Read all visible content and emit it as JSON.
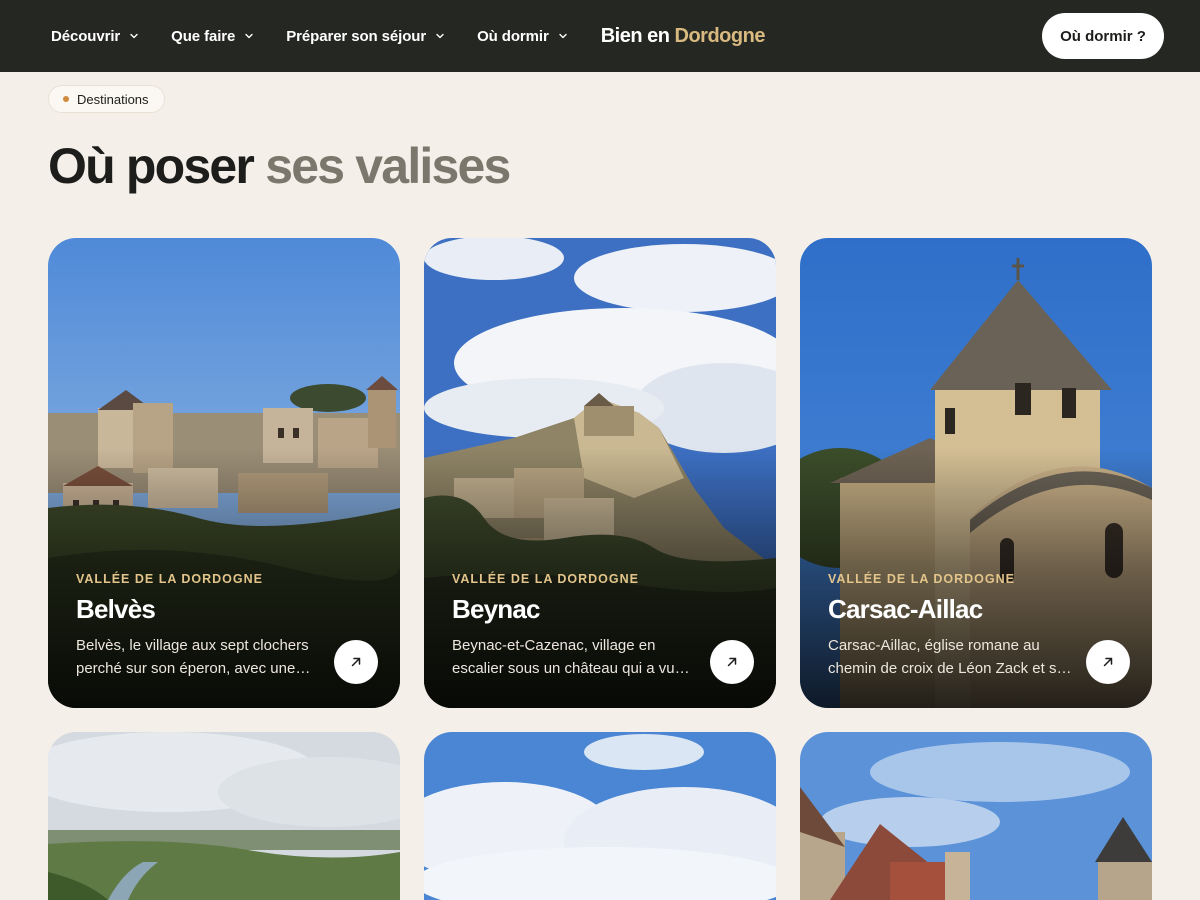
{
  "nav": {
    "items": [
      {
        "label": "Découvrir"
      },
      {
        "label": "Que faire"
      },
      {
        "label": "Préparer son séjour"
      },
      {
        "label": "Où dormir"
      }
    ],
    "brand_prefix": "Bien en",
    "brand_accent": "Dordogne",
    "cta_label": "Où dormir ?"
  },
  "section": {
    "pill_label": "Destinations",
    "title_main": "Où poser",
    "title_muted": "ses valises"
  },
  "cards": [
    {
      "region": "VALLÉE DE LA DORDOGNE",
      "name": "Belvès",
      "desc": "Belvès, le village aux sept clochers perché sur son éperon, avec une vue imprenable sur la vallée",
      "icon": "arrow-up-right-icon"
    },
    {
      "region": "VALLÉE DE LA DORDOGNE",
      "name": "Beynac",
      "desc": "Beynac-et-Cazenac, village en escalier sous un château qui a vu passer les siècles",
      "icon": "arrow-up-right-icon"
    },
    {
      "region": "VALLÉE DE LA DORDOGNE",
      "name": "Carsac-Aillac",
      "desc": "Carsac-Aillac, église romane au chemin de croix de Léon Zack et ses ruelles paisibles",
      "icon": "arrow-up-right-icon"
    }
  ],
  "colors": {
    "nav_bg": "#252723",
    "page_bg": "#f4efe8",
    "accent_gold": "#d8b97f",
    "pill_dot": "#d08a3c"
  }
}
